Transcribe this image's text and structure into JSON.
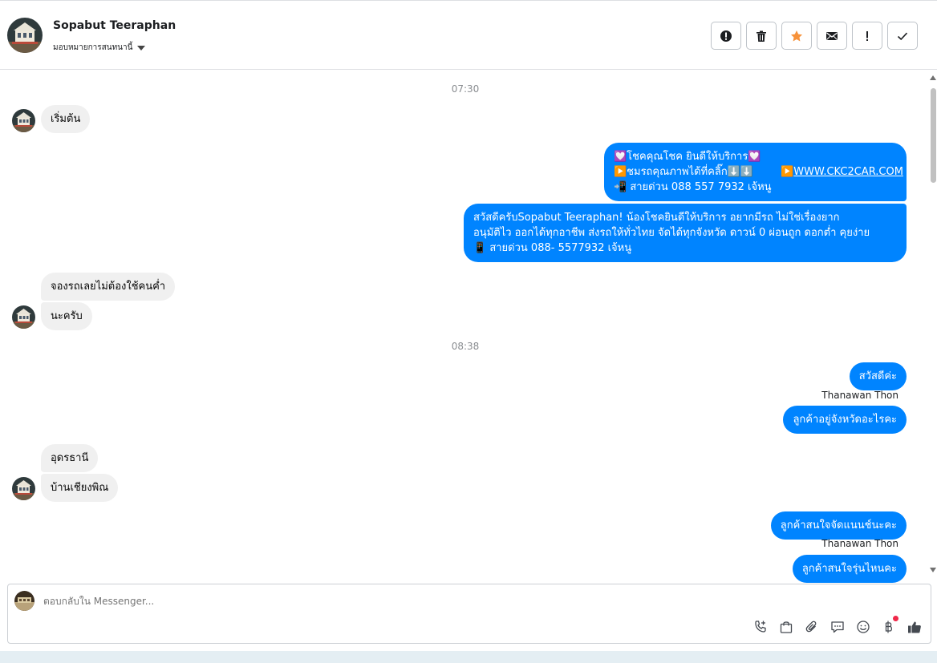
{
  "header": {
    "contact_name": "Sopabut Teeraphan",
    "assign_label": "มอบหมายการสนทนานี้",
    "actions": [
      {
        "name": "spam-button",
        "icon": "alert-circle-icon"
      },
      {
        "name": "delete-button",
        "icon": "trash-icon"
      },
      {
        "name": "star-button",
        "icon": "star-icon",
        "color": "#f7923a"
      },
      {
        "name": "mark-unread-button",
        "icon": "envelope-icon"
      },
      {
        "name": "follow-up-button",
        "icon": "exclamation-icon"
      },
      {
        "name": "done-button",
        "icon": "check-icon"
      }
    ]
  },
  "messages": {
    "time1": "07:30",
    "m1": "เริ่มต้น",
    "promo_line1": "💟โชคคุณโชค ยินดีให้บริการ💟",
    "promo_line2a": "▶️ชมรถคุณภาพได้ที่คลิ๊ก⬇️⬇️",
    "promo_line2b": "▶️",
    "promo_link": "WWW.CKC2CAR.COM",
    "promo_line3": "📲 สายด่วน 088 557 7932 เจ้หนู",
    "greet_line1": "สวัสดีครับSopabut Teeraphan! น้องโชคยินดีให้บริการ อยากมีรถ ไม่ใช่เรื่องยาก",
    "greet_line2": "อนุมัติไว ออกได้ทุกอาชีพ ส่งรถให้ทั่วไทย จัดได้ทุกจังหวัด ดาวน์ 0  ผ่อนถูก ดอกต่ำ คุยง่าย",
    "greet_line3": "📱 สายด่วน 088- 5577932 เจ้หนู",
    "m2": "จองรถเลยไม่ต้องใช้คนค่ำ",
    "m3": "นะครับ",
    "time2": "08:38",
    "m4": "สวัสดีค่ะ",
    "sender1": "Thanawan Thon",
    "m5": "ลูกค้าอยู่จังหวัดอะไรคะ",
    "m6": "อุดรธานี",
    "m7": "บ้านเชียงพิณ",
    "m8": "ลูกค้าสนใจจัดแนนช์นะคะ",
    "sender2": "Thanawan Thon",
    "m9": "ลูกค้าสนใจรุ่นไหนคะ"
  },
  "composer": {
    "placeholder": "ตอบกลับใน Messenger...",
    "tools": [
      "phone-add-icon",
      "shopping-bag-icon",
      "paperclip-icon",
      "chat-bubble-icon",
      "smiley-icon",
      "baht-icon",
      "thumbs-up-icon"
    ]
  },
  "colors": {
    "outgoing": "#0084ff",
    "incoming": "#f0f0f0",
    "accent_star": "#f7923a"
  }
}
